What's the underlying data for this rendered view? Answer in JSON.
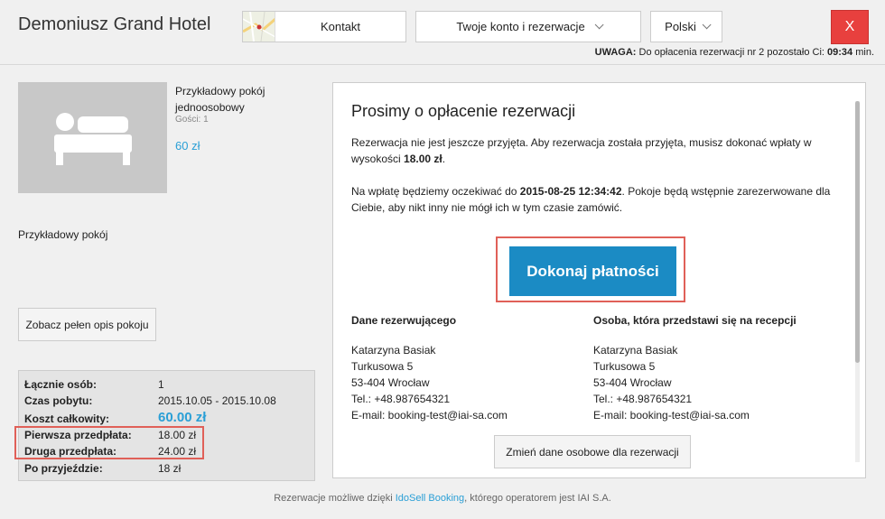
{
  "header": {
    "hotel_name": "Demoniusz Grand Hotel",
    "contact_label": "Kontakt",
    "account_label": "Twoje konto i rezerwacje",
    "language_label": "Polski",
    "close_label": "X",
    "warning_prefix": "UWAGA:",
    "warning_text": "Do opłacenia rezerwacji nr 2 pozostało Ci:",
    "warning_time": "09:34",
    "warning_unit": "min."
  },
  "room": {
    "name": "Przykładowy pokój jednoosobowy",
    "guests": "Gości: 1",
    "price": "60 zł",
    "description": "Przykładowy pokój",
    "full_description_button": "Zobacz pełen opis pokoju",
    "photo_icon": "bed-icon"
  },
  "summary": {
    "rows": [
      {
        "label": "Łącznie osób:",
        "value": "1"
      },
      {
        "label": "Czas pobytu:",
        "value": "2015.10.05 - 2015.10.08"
      },
      {
        "label": "Koszt całkowity:",
        "value": "60.00 zł"
      },
      {
        "label": "Pierwsza przedpłata:",
        "value": "18.00 zł"
      },
      {
        "label": "Druga przedpłata:",
        "value": "24.00 zł"
      },
      {
        "label": "Po przyjeździe:",
        "value": "18 zł"
      }
    ]
  },
  "panel": {
    "title": "Prosimy o opłacenie rezerwacji",
    "p1_a": "Rezerwacja nie jest jeszcze przyjęta. Aby rezerwacja została przyjęta, musisz dokonać wpłaty w wysokości ",
    "p1_amount": "18.00 zł",
    "p1_end": ".",
    "p2_a": "Na wpłatę będziemy oczekiwać do ",
    "p2_date": "2015-08-25 12:34:42",
    "p2_b": ". Pokoje będą wstępnie zarezerwowane dla Ciebie, aby nikt inny nie mógł ich w tym czasie zamówić.",
    "pay_button": "Dokonaj płatności",
    "booker_title": "Dane rezerwującego",
    "guest_title": "Osoba, która przedstawi się na recepcji",
    "booker": {
      "name": "Katarzyna Basiak",
      "street": "Turkusowa 5",
      "city": "53-404 Wrocław",
      "phone": "Tel.: +48.987654321",
      "email": "E-mail: booking-test@iai-sa.com"
    },
    "guest": {
      "name": "Katarzyna Basiak",
      "street": "Turkusowa 5",
      "city": "53-404 Wrocław",
      "phone": "Tel.: +48.987654321",
      "email": "E-mail: booking-test@iai-sa.com"
    },
    "change_button": "Zmień dane osobowe dla rezerwacji"
  },
  "footer": {
    "prefix": "Rezerwacje możliwe dzięki ",
    "link": "IdoSell Booking",
    "suffix": ", którego operatorem jest IAI S.A."
  },
  "colors": {
    "accent": "#2a9fd6",
    "pay_button": "#1b8bc4",
    "close_button": "#e8403e",
    "highlight": "#e06058"
  }
}
